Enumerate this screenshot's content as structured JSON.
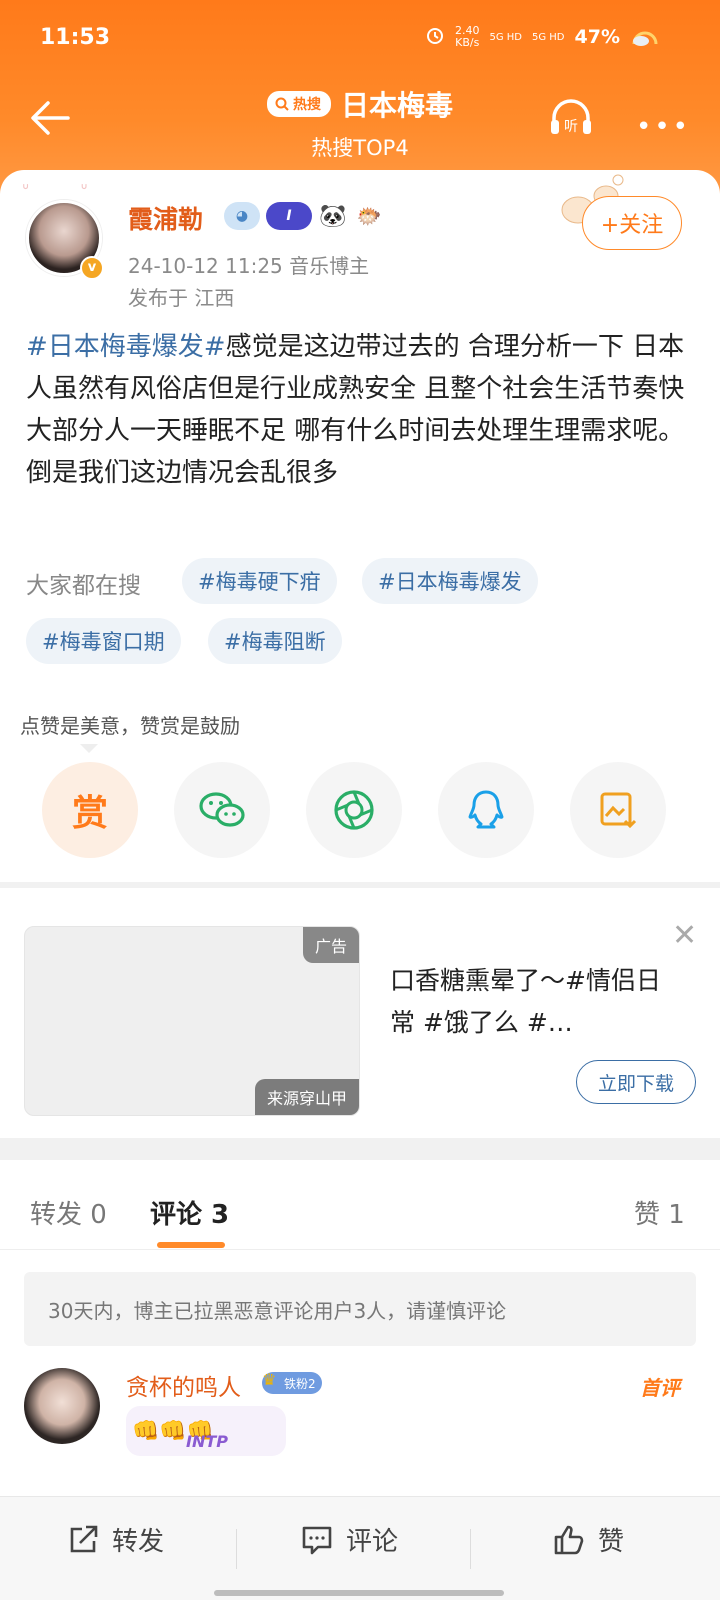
{
  "status": {
    "time": "11:53",
    "speed_value": "2.40",
    "speed_unit": "KB/s",
    "sig1": "5G HD",
    "sig2": "5G HD",
    "battery": "47%"
  },
  "header": {
    "hot_badge": "热搜",
    "title": "日本梅毒",
    "subtitle": "热搜TOP4",
    "listen": "听"
  },
  "post": {
    "username": "霞浦勒",
    "badge_i": "I",
    "time_role": "24-10-12 11:25  音乐博主",
    "location": "发布于 江西",
    "follow": "+关注",
    "content_tag": "#日本梅毒爆发#",
    "content_text": "感觉是这边带过去的 合理分析一下 日本人虽然有风俗店但是行业成熟安全 且整个社会生活节奏快 大部分人一天睡眠不足 哪有什么时间去处理生理需求呢。 倒是我们这边情况会乱很多",
    "search_label": "大家都在搜",
    "chips": [
      "#梅毒硬下疳",
      "#日本梅毒爆发",
      "#梅毒窗口期",
      "#梅毒阻断"
    ],
    "like_hint": "点赞是美意，赞赏是鼓励",
    "reward": "赏"
  },
  "ad": {
    "label": "广告",
    "source": "来源穿山甲",
    "text": "口香糖熏晕了～#情侣日常 #饿了么 #…",
    "download": "立即下载"
  },
  "tabs": {
    "repost": "转发 0",
    "comment": "评论 3",
    "like": "赞 1"
  },
  "notice": "30天内，博主已拉黑恶意评论用户3人，请谨慎评论",
  "comment": {
    "name": "贪杯的鸣人",
    "fan_badge": "铁粉2",
    "first": "首评",
    "body_emoji": "👊👊👊",
    "sticker": "INTP"
  },
  "bottom": {
    "repost": "转发",
    "comment": "评论",
    "like": "赞"
  },
  "colors": {
    "header_orange": "#ff7a1a",
    "name_orange": "#e25d1a",
    "tag_blue": "#3b6ea5"
  }
}
